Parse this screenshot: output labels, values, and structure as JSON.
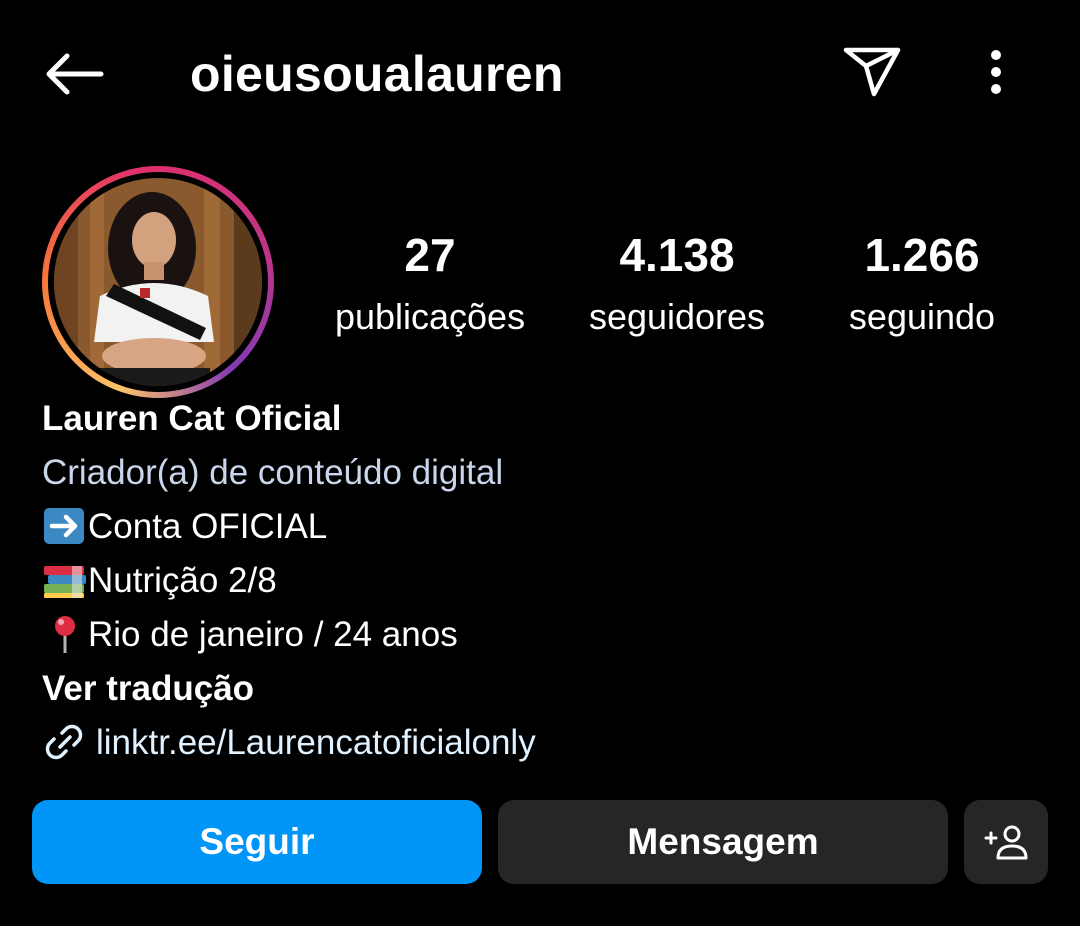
{
  "header": {
    "username": "oieusoualauren",
    "back_icon": "arrow-left-icon",
    "send_icon": "paper-plane-icon",
    "more_icon": "more-vertical-icon"
  },
  "stats": [
    {
      "value": "27",
      "label": "publicações"
    },
    {
      "value": "4.138",
      "label": "seguidores"
    },
    {
      "value": "1.266",
      "label": "seguindo"
    }
  ],
  "bio": {
    "display_name": "Lauren Cat Oficial",
    "category": "Criador(a) de conteúdo digital",
    "lines": [
      {
        "emoji": "arrow-right-emoji",
        "text": "Conta OFICIAL"
      },
      {
        "emoji": "books-emoji",
        "text": "Nutrição 2/8"
      },
      {
        "emoji": "round-pushpin-emoji",
        "text": "Rio de janeiro / 24 anos"
      }
    ],
    "translate_label": "Ver tradução",
    "link": "linktr.ee/Laurencatoficialonly",
    "link_icon": "link-icon"
  },
  "actions": {
    "follow_label": "Seguir",
    "message_label": "Mensagem",
    "add_friend_icon": "add-person-icon"
  },
  "colors": {
    "background": "#000000",
    "follow_button": "#0095f6",
    "secondary_button": "#262626",
    "category_text": "#c9d5ea",
    "link_text": "#e0f1ff"
  }
}
